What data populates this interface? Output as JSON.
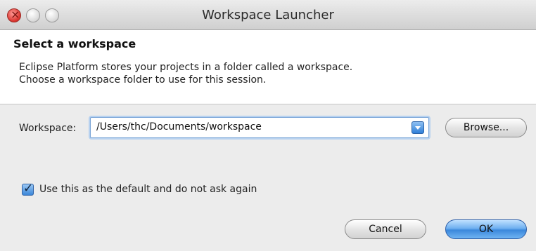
{
  "window": {
    "title": "Workspace Launcher"
  },
  "header": {
    "title": "Select a workspace",
    "desc_line1": "Eclipse Platform stores your projects in a folder called a workspace.",
    "desc_line2": "Choose a workspace folder to use for this session."
  },
  "workspace": {
    "label": "Workspace:",
    "value": "/Users/thc/Documents/workspace",
    "browse_label": "Browse..."
  },
  "default_option": {
    "label": "Use this as the default and do not ask again",
    "checked": true
  },
  "buttons": {
    "cancel": "Cancel",
    "ok": "OK"
  },
  "icons": {
    "close": "close-icon",
    "minimize": "minimize-icon",
    "zoom": "zoom-icon",
    "dropdown": "chevron-down-icon",
    "check": "checkmark-icon"
  }
}
